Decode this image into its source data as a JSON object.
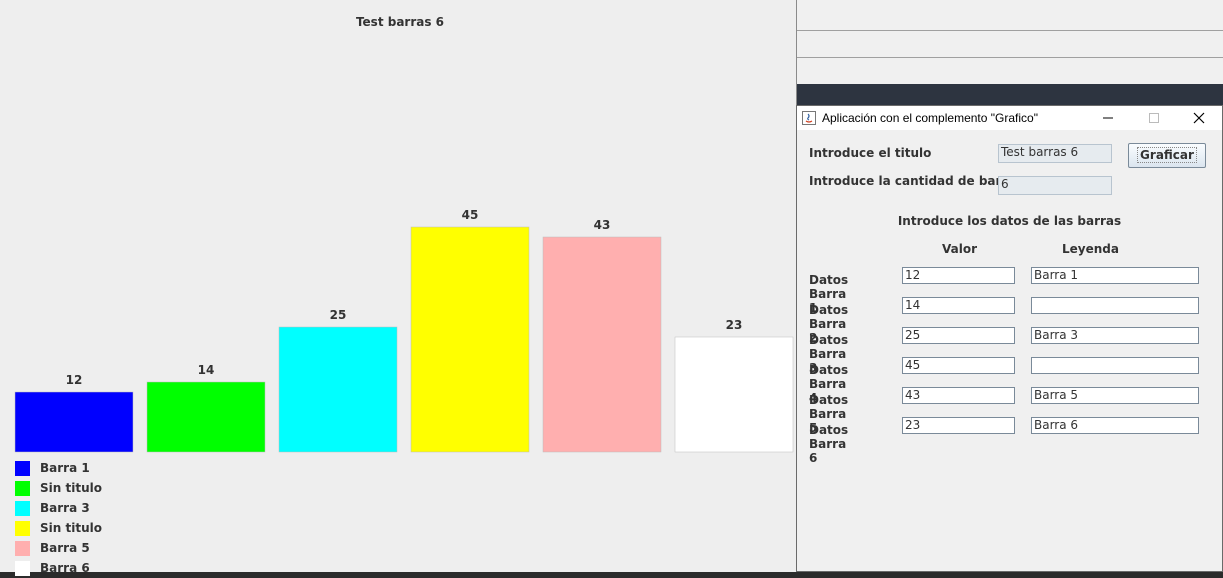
{
  "chart_window": {
    "title": "Test barras 6"
  },
  "chart_data": {
    "type": "bar",
    "title": "Test barras 6",
    "categories": [
      "Barra 1",
      "Sin titulo",
      "Barra 3",
      "Sin titulo",
      "Barra 5",
      "Barra 6"
    ],
    "values": [
      12,
      14,
      25,
      45,
      43,
      23
    ],
    "colors": [
      "#0000ff",
      "#00ff00",
      "#00ffff",
      "#ffff00",
      "#ffafaf",
      "#ffffff"
    ],
    "legend_position": "bottom-left",
    "grid": false
  },
  "dialog": {
    "title": "Aplicación con el complemento \"Grafico\"",
    "minimize_icon": "minimize-icon",
    "maximize_icon": "maximize-icon",
    "close_icon": "close-icon",
    "title_label": "Introduce el titulo",
    "title_value": "Test barras 6",
    "count_label": "Introduce la cantidad de barras",
    "count_value": "6",
    "graficar_label": "Graficar",
    "data_header": "Introduce los datos de las barras",
    "col_valor": "Valor",
    "col_leyenda": "Leyenda",
    "rows": [
      {
        "label": "Datos Barra 1",
        "valor": "12",
        "leyenda": "Barra 1"
      },
      {
        "label": "Datos Barra 2",
        "valor": "14",
        "leyenda": ""
      },
      {
        "label": "Datos Barra 3",
        "valor": "25",
        "leyenda": "Barra 3"
      },
      {
        "label": "Datos Barra 4",
        "valor": "45",
        "leyenda": ""
      },
      {
        "label": "Datos Barra 5",
        "valor": "43",
        "leyenda": "Barra 5"
      },
      {
        "label": "Datos Barra 6",
        "valor": "23",
        "leyenda": "Barra 6"
      }
    ]
  }
}
